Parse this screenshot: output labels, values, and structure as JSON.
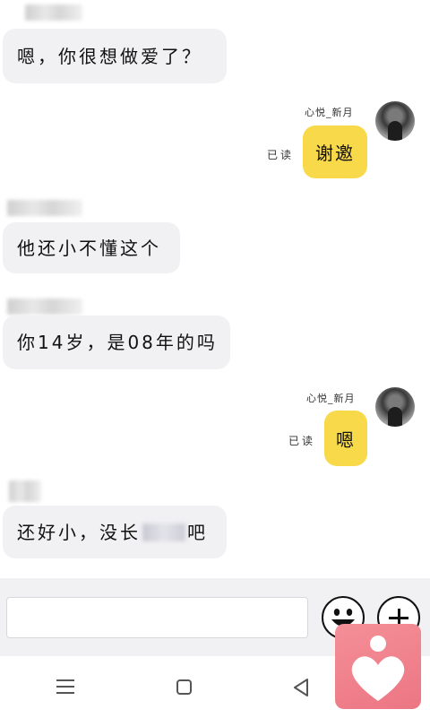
{
  "chat": {
    "messages": [
      {
        "side": "left",
        "text": "嗯，你很想做爱了？"
      },
      {
        "side": "right",
        "nickname": "心悦_新月",
        "read_status": "已读",
        "text": "谢邀"
      },
      {
        "side": "left",
        "text": "他还小不懂这个"
      },
      {
        "side": "left",
        "text": "你14岁，是08年的吗"
      },
      {
        "side": "right",
        "nickname": "心悦_新月",
        "read_status": "已读",
        "text": "嗯"
      },
      {
        "side": "left",
        "text_before": "还好小，没长",
        "text_after": "吧"
      }
    ]
  },
  "input": {
    "value": "",
    "placeholder": ""
  },
  "icons": {
    "emoji": "smiley-face-icon",
    "plus": "plus-icon",
    "menu": "menu-icon",
    "home": "square-home-icon",
    "back": "triangle-back-icon",
    "app": "heart-person-icon"
  },
  "colors": {
    "own_bubble": "#f8d94a",
    "other_bubble": "#f1f1f4",
    "input_bar": "#f1f1f4",
    "app_badge": "#ee7b87"
  }
}
